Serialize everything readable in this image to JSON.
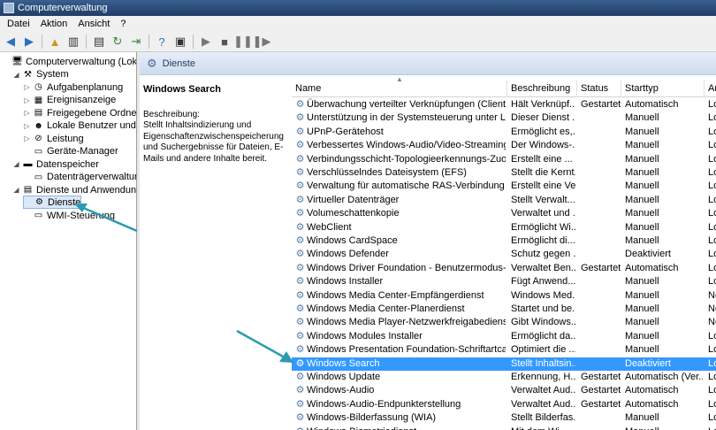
{
  "window": {
    "title": "Computerverwaltung"
  },
  "menu": [
    "Datei",
    "Aktion",
    "Ansicht",
    "?"
  ],
  "tree": [
    {
      "label": "Computerverwaltung (Lokal)",
      "level": 0,
      "twisty": "",
      "icon": "computer-icon",
      "glyph": "🖥"
    },
    {
      "label": "System",
      "level": 1,
      "twisty": "◢",
      "icon": "tools-icon",
      "glyph": "⚒"
    },
    {
      "label": "Aufgabenplanung",
      "level": 2,
      "twisty": "▷",
      "icon": "clock-icon",
      "glyph": "◷"
    },
    {
      "label": "Ereignisanzeige",
      "level": 2,
      "twisty": "▷",
      "icon": "event-viewer-icon",
      "glyph": "▦"
    },
    {
      "label": "Freigegebene Ordner",
      "level": 2,
      "twisty": "▷",
      "icon": "shared-folder-icon",
      "glyph": "▤"
    },
    {
      "label": "Lokale Benutzer und Gr",
      "level": 2,
      "twisty": "▷",
      "icon": "users-icon",
      "glyph": "☻"
    },
    {
      "label": "Leistung",
      "level": 2,
      "twisty": "▷",
      "icon": "performance-icon",
      "glyph": "⊘"
    },
    {
      "label": "Geräte-Manager",
      "level": 2,
      "twisty": "",
      "icon": "device-manager-icon",
      "glyph": "▭"
    },
    {
      "label": "Datenspeicher",
      "level": 1,
      "twisty": "◢",
      "icon": "storage-icon",
      "glyph": "▬"
    },
    {
      "label": "Datenträgerverwaltung",
      "level": 2,
      "twisty": "",
      "icon": "disk-icon",
      "glyph": "▭"
    },
    {
      "label": "Dienste und Anwendungen",
      "level": 1,
      "twisty": "◢",
      "icon": "services-apps-icon",
      "glyph": "▤"
    },
    {
      "label": "Dienste",
      "level": 2,
      "twisty": "",
      "icon": "gear-icon",
      "glyph": "⚙",
      "selected": true
    },
    {
      "label": "WMI-Steuerung",
      "level": 2,
      "twisty": "",
      "icon": "wmi-icon",
      "glyph": "▭"
    }
  ],
  "header": {
    "title": "Dienste"
  },
  "detail": {
    "service_name": "Windows Search",
    "description_label": "Beschreibung:",
    "description": "Stellt Inhaltsindizierung und Eigenschaftenzwischenspeicherung und Suchergebnisse für Dateien, E-Mails und andere Inhalte bereit."
  },
  "columns": [
    "Name",
    "Beschreibung",
    "Status",
    "Starttyp",
    "Ar"
  ],
  "services": [
    {
      "name": "Überwachung verteilter Verknüpfungen (Client)",
      "desc": "Hält Verknüpf...",
      "status": "Gestartet",
      "start": "Automatisch",
      "login": "Lo"
    },
    {
      "name": "Unterstützung in der Systemsteuerung unter Lösun...",
      "desc": "Dieser Dienst ...",
      "status": "",
      "start": "Manuell",
      "login": "Lo"
    },
    {
      "name": "UPnP-Gerätehost",
      "desc": "Ermöglicht es,...",
      "status": "",
      "start": "Manuell",
      "login": "Lo"
    },
    {
      "name": "Verbessertes Windows-Audio/Video-Streaming",
      "desc": "Der Windows-...",
      "status": "",
      "start": "Manuell",
      "login": "Lo"
    },
    {
      "name": "Verbindungsschicht-Topologieerkennungs-Zuord...",
      "desc": "Erstellt eine ...",
      "status": "",
      "start": "Manuell",
      "login": "Lo"
    },
    {
      "name": "Verschlüsselndes Dateisystem (EFS)",
      "desc": "Stellt die Kernt...",
      "status": "",
      "start": "Manuell",
      "login": "Lo"
    },
    {
      "name": "Verwaltung für automatische RAS-Verbindung",
      "desc": "Erstellt eine Ve...",
      "status": "",
      "start": "Manuell",
      "login": "Lo"
    },
    {
      "name": "Virtueller Datenträger",
      "desc": "Stellt Verwalt...",
      "status": "",
      "start": "Manuell",
      "login": "Lo"
    },
    {
      "name": "Volumeschattenkopie",
      "desc": "Verwaltet und ...",
      "status": "",
      "start": "Manuell",
      "login": "Lo"
    },
    {
      "name": "WebClient",
      "desc": "Ermöglicht Wi...",
      "status": "",
      "start": "Manuell",
      "login": "Lo"
    },
    {
      "name": "Windows CardSpace",
      "desc": "Ermöglicht di...",
      "status": "",
      "start": "Manuell",
      "login": "Lo"
    },
    {
      "name": "Windows Defender",
      "desc": "Schutz gegen ...",
      "status": "",
      "start": "Deaktiviert",
      "login": "Lo"
    },
    {
      "name": "Windows Driver Foundation - Benutzermodus-Trei...",
      "desc": "Verwaltet Ben...",
      "status": "Gestartet",
      "start": "Automatisch",
      "login": "Lo"
    },
    {
      "name": "Windows Installer",
      "desc": "Fügt Anwend...",
      "status": "",
      "start": "Manuell",
      "login": "Lo"
    },
    {
      "name": "Windows Media Center-Empfängerdienst",
      "desc": "Windows Med...",
      "status": "",
      "start": "Manuell",
      "login": "Ne"
    },
    {
      "name": "Windows Media Center-Planerdienst",
      "desc": "Startet und be...",
      "status": "",
      "start": "Manuell",
      "login": "Ne"
    },
    {
      "name": "Windows Media Player-Netzwerkfreigabedienst",
      "desc": "Gibt Windows...",
      "status": "",
      "start": "Manuell",
      "login": "Ne"
    },
    {
      "name": "Windows Modules Installer",
      "desc": "Ermöglicht da...",
      "status": "",
      "start": "Manuell",
      "login": "Lo"
    },
    {
      "name": "Windows Presentation Foundation-Schriftartcache...",
      "desc": "Optimiert die ...",
      "status": "",
      "start": "Manuell",
      "login": "Lo"
    },
    {
      "name": "Windows Search",
      "desc": "Stellt Inhaltsin...",
      "status": "",
      "start": "Deaktiviert",
      "login": "Lo",
      "selected": true
    },
    {
      "name": "Windows Update",
      "desc": "Erkennung, H...",
      "status": "Gestartet",
      "start": "Automatisch (Ver...",
      "login": "Lo"
    },
    {
      "name": "Windows-Audio",
      "desc": "Verwaltet Aud...",
      "status": "Gestartet",
      "start": "Automatisch",
      "login": "Lo"
    },
    {
      "name": "Windows-Audio-Endpunkterstellung",
      "desc": "Verwaltet Aud...",
      "status": "Gestartet",
      "start": "Automatisch",
      "login": "Lo"
    },
    {
      "name": "Windows-Bilderfassung (WIA)",
      "desc": "Stellt Bilderfas...",
      "status": "",
      "start": "Manuell",
      "login": "Lo"
    },
    {
      "name": "Windows-Biometriedienst",
      "desc": "Mit dem Wi...",
      "status": "",
      "start": "Manuell",
      "login": "Lo"
    }
  ],
  "colors": {
    "selection": "#3399ff",
    "annotation_arrow": "#2a9bb0"
  }
}
